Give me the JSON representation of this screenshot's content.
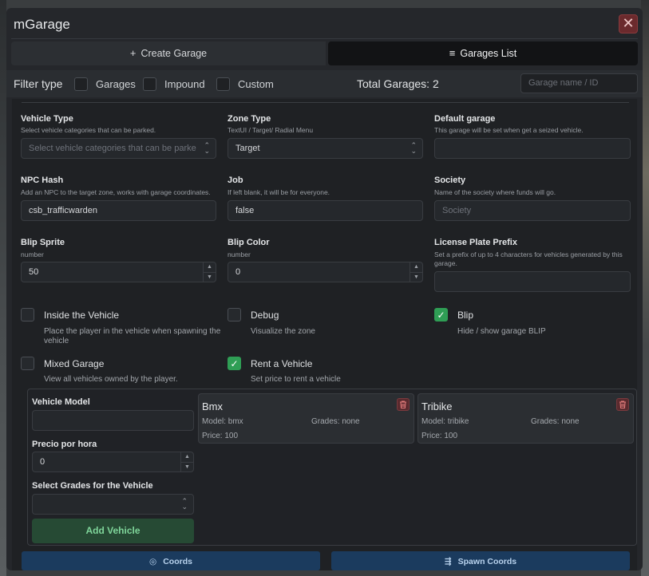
{
  "app": {
    "title": "mGarage",
    "close_label": "✕"
  },
  "tabs": [
    {
      "label": "Create Garage",
      "icon": "plus-icon",
      "glyph": "+"
    },
    {
      "label": "Garages List",
      "icon": "list-icon",
      "glyph": "≡"
    }
  ],
  "filter": {
    "label": "Filter type",
    "options": [
      "Garages",
      "Impound",
      "Custom"
    ],
    "total_text": "Total Garages: 2",
    "search_placeholder": "Garage name / ID"
  },
  "fields": {
    "vehicle_type": {
      "label": "Vehicle Type",
      "desc": "Select vehicle categories that can be parked.",
      "placeholder": "Select vehicle categories that can be parke"
    },
    "zone_type": {
      "label": "Zone Type",
      "desc": "TextUI / Target/ Radial Menu",
      "value": "Target"
    },
    "default_garage": {
      "label": "Default garage",
      "desc": "This garage will be set when get a seized vehicle.",
      "value": ""
    },
    "npc_hash": {
      "label": "NPC Hash",
      "desc": "Add an NPC to the target zone, works with garage coordinates.",
      "value": "csb_trafficwarden"
    },
    "job": {
      "label": "Job",
      "desc": "If left blank, it will be for everyone.",
      "value": "false"
    },
    "society": {
      "label": "Society",
      "desc": "Name of the society where funds will go.",
      "placeholder": "Society"
    },
    "blip_sprite": {
      "label": "Blip Sprite",
      "desc": "number",
      "value": "50"
    },
    "blip_color": {
      "label": "Blip Color",
      "desc": "number",
      "value": "0"
    },
    "plate_prefix": {
      "label": "License Plate Prefix",
      "desc": "Set a prefix of up to 4 characters for vehicles generated by this garage.",
      "value": ""
    }
  },
  "toggles": {
    "inside_vehicle": {
      "label": "Inside the Vehicle",
      "desc": "Place the player in the vehicle when spawning the vehicle",
      "checked": false
    },
    "debug": {
      "label": "Debug",
      "desc": "Visualize the zone",
      "checked": false
    },
    "blip": {
      "label": "Blip",
      "desc": "Hide / show garage BLIP",
      "checked": true
    },
    "mixed_garage": {
      "label": "Mixed Garage",
      "desc": "View all vehicles owned by the player.",
      "checked": false
    },
    "rent_vehicle": {
      "label": "Rent a Vehicle",
      "desc": "Set price to rent a vehicle",
      "checked": true
    }
  },
  "rental": {
    "model_label": "Vehicle Model",
    "model_value": "",
    "price_label": "Precio por hora",
    "price_value": "0",
    "grades_label": "Select Grades for the Vehicle",
    "add_button": "Add Vehicle",
    "vehicles": [
      {
        "name": "Bmx",
        "model": "Model: bmx",
        "grades": "Grades: none",
        "price": "Price: 100"
      },
      {
        "name": "Tribike",
        "model": "Model: tribike",
        "grades": "Grades: none",
        "price": "Price: 100"
      }
    ]
  },
  "actions": {
    "coords": "Coords",
    "spawn_coords": "Spawn Coords"
  },
  "colors": {
    "accent_green": "#2f9e55",
    "danger": "#6b2a2d",
    "action_blue": "#1b3b5e"
  }
}
